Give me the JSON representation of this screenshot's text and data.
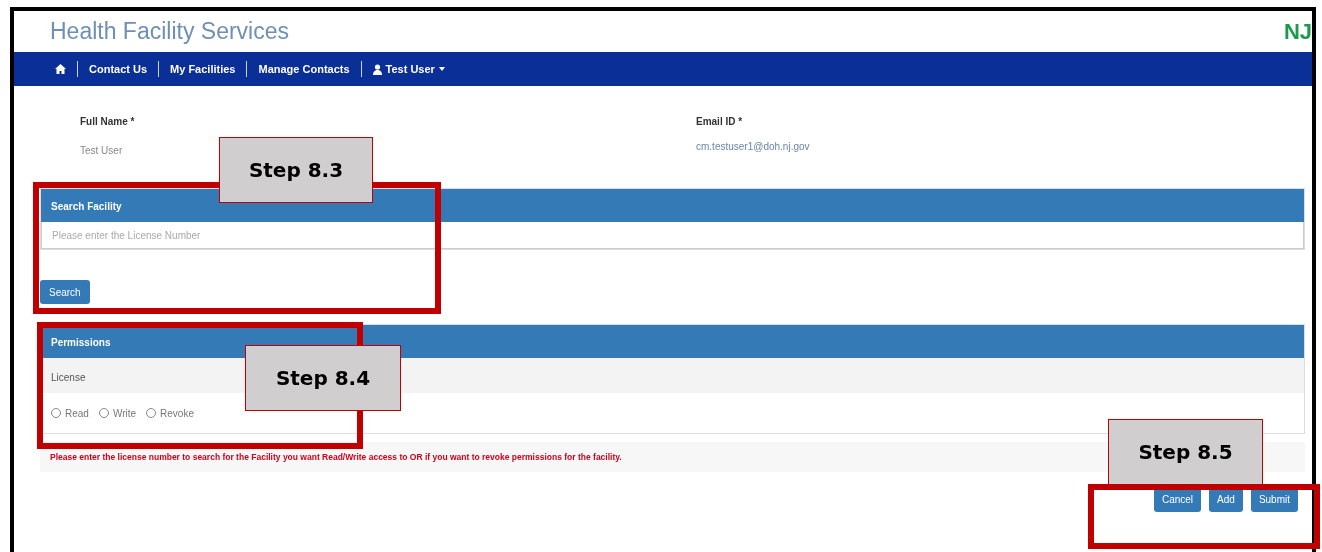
{
  "header": {
    "title": "Health Facility Services",
    "logo": "NJ"
  },
  "nav": {
    "items": [
      {
        "kind": "home"
      },
      {
        "kind": "link",
        "label": "Contact Us"
      },
      {
        "kind": "link",
        "label": "My Facilities"
      },
      {
        "kind": "link",
        "label": "Manage Contacts"
      },
      {
        "kind": "user",
        "label": "Test User"
      }
    ]
  },
  "profile": [
    {
      "label": "Full Name *",
      "value": "Test User"
    },
    {
      "label": "Email ID *",
      "value": "cm.testuser1@doh.nj.gov"
    }
  ],
  "search_panel": {
    "title": "Search Facility",
    "placeholder": "Please enter the License Number",
    "button": "Search"
  },
  "permissions": {
    "title": "Permissions",
    "row_label": "License",
    "options": [
      {
        "label": "Read",
        "checked": false
      },
      {
        "label": "Write",
        "checked": false
      },
      {
        "label": "Revoke",
        "checked": false
      }
    ]
  },
  "message": "Please enter the license number to search for the Facility you want Read/Write access to OR if you want to revoke permissions for the facility.",
  "actions": [
    "Cancel",
    "Add",
    "Submit"
  ],
  "annotations": [
    {
      "label": "Step 8.3"
    },
    {
      "label": "Step 8.4"
    },
    {
      "label": "Step 8.5"
    }
  ]
}
